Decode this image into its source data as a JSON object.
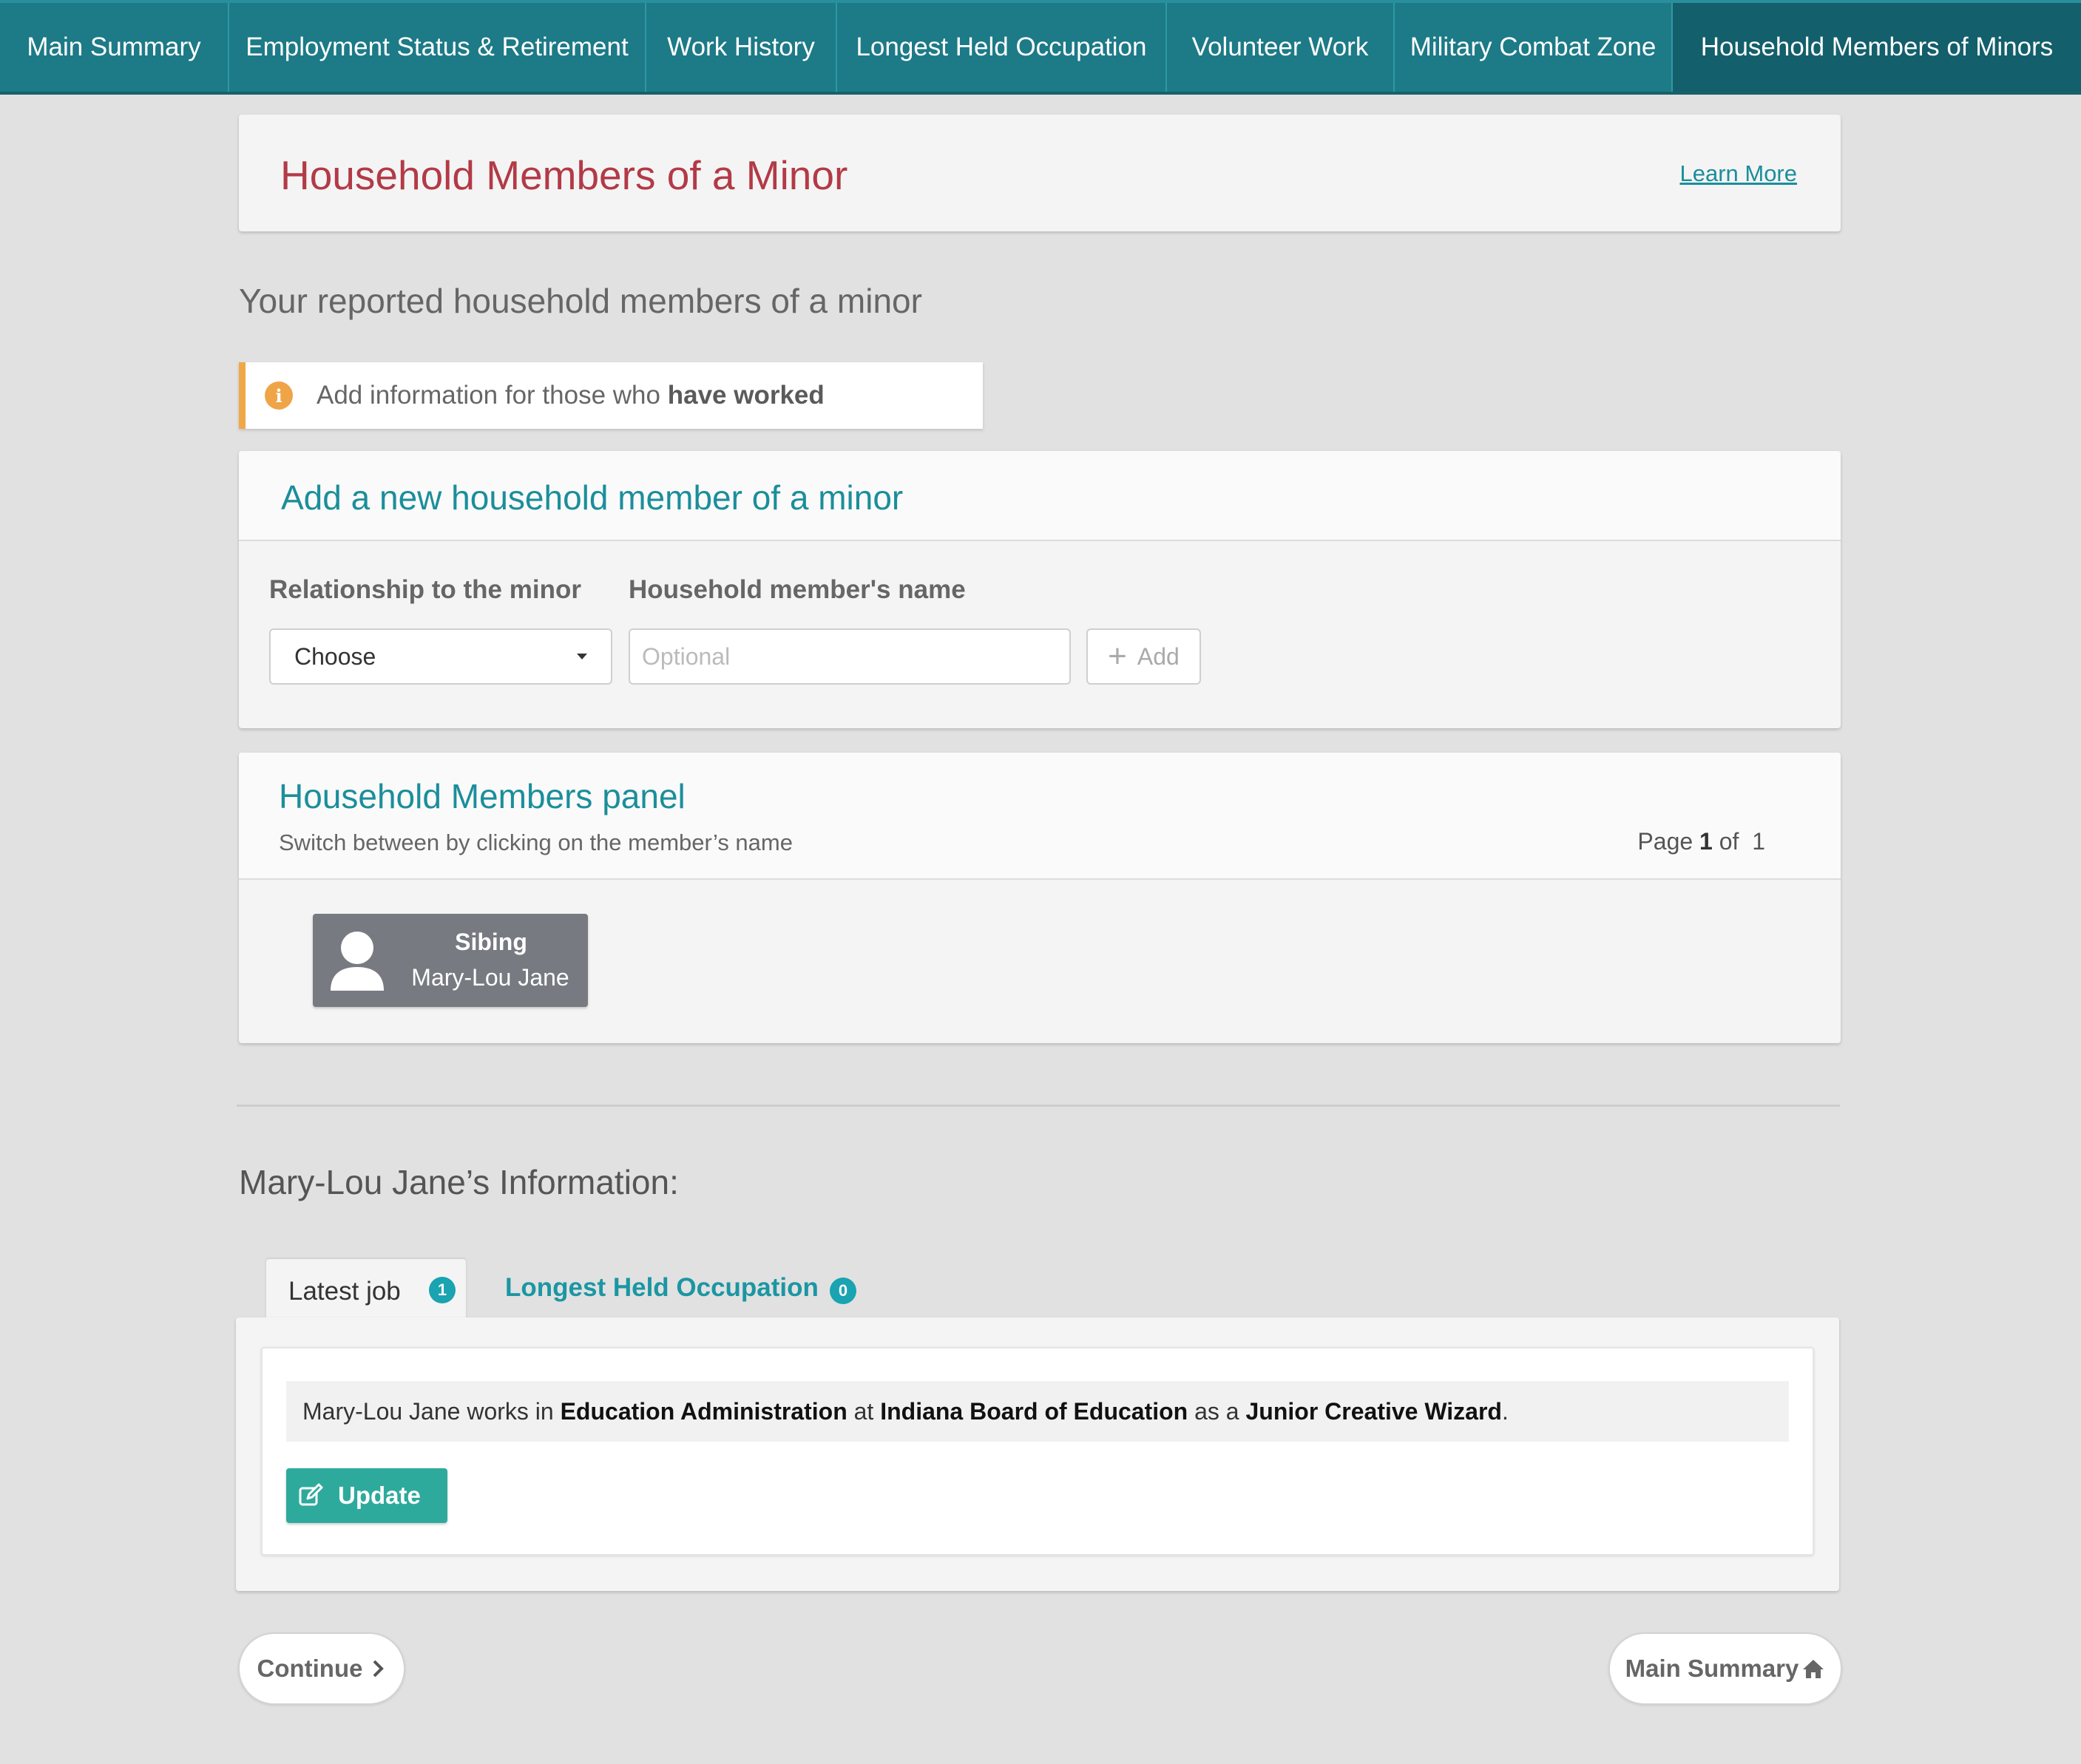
{
  "nav": {
    "tabs": [
      {
        "label": "Main Summary"
      },
      {
        "label": "Employment Status & Retirement"
      },
      {
        "label": "Work History"
      },
      {
        "label": "Longest Held Occupation"
      },
      {
        "label": "Volunteer Work"
      },
      {
        "label": "Military Combat Zone"
      },
      {
        "label": "Household Members of Minors"
      }
    ],
    "active_index": 6
  },
  "header": {
    "title": "Household Members of a Minor",
    "learn_more": "Learn More"
  },
  "subheading": "Your reported household members of a minor",
  "alert": {
    "text_prefix": "Add information for those who ",
    "text_bold": "have worked",
    "icon": "info-icon"
  },
  "add_form": {
    "title": "Add a new household member of a minor",
    "relationship_label": "Relationship to the minor",
    "relationship_value": "Choose",
    "name_label": "Household member's name",
    "name_placeholder": "Optional",
    "add_label": "Add"
  },
  "members_panel": {
    "title": "Household Members panel",
    "subtitle": "Switch between by clicking on the member’s name",
    "page_prefix": "Page",
    "page_current": "1",
    "page_of": "of",
    "page_total": "1",
    "members": [
      {
        "relationship": "Sibing",
        "name": "Mary-Lou Jane"
      }
    ]
  },
  "info": {
    "title": "Mary-Lou Jane’s Information:",
    "tabs": [
      {
        "label": "Latest job",
        "count": "1"
      },
      {
        "label": "Longest Held Occupation",
        "count": "0"
      }
    ],
    "sentence": {
      "p1": "Mary-Lou Jane works in ",
      "industry": "Education Administration",
      "p2": " at ",
      "employer": "Indiana Board of Education",
      "p3": " as a ",
      "job": "Junior Creative Wizard",
      "p4": "."
    },
    "update_label": "Update"
  },
  "footer": {
    "continue_label": "Continue",
    "main_summary_label": "Main Summary"
  },
  "colors": {
    "nav_bg": "#1d7a87",
    "nav_active": "#135f6b",
    "title_red": "#b23a46",
    "accent_teal": "#1b8e9b",
    "alert_orange": "#f0a847",
    "update_green": "#2eaa9c"
  }
}
